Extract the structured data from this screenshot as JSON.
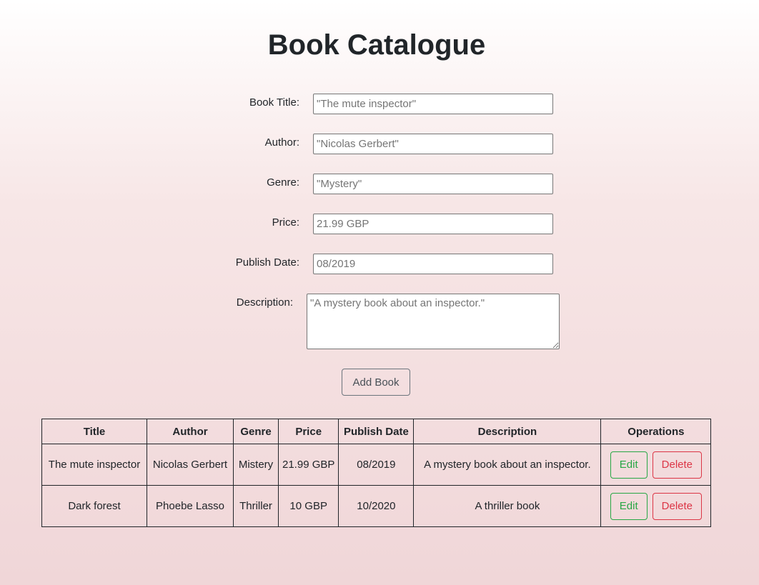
{
  "header": {
    "title": "Book Catalogue"
  },
  "form": {
    "title_label": "Book Title:",
    "title_placeholder": "\"The mute inspector\"",
    "author_label": "Author:",
    "author_placeholder": "\"Nicolas Gerbert\"",
    "genre_label": "Genre:",
    "genre_placeholder": "\"Mystery\"",
    "price_label": "Price:",
    "price_placeholder": "21.99 GBP",
    "date_label": "Publish Date:",
    "date_placeholder": "08/2019",
    "description_label": "Description:",
    "description_placeholder": "\"A mystery book about an inspector.\"",
    "add_label": "Add Book"
  },
  "table": {
    "headers": [
      "Title",
      "Author",
      "Genre",
      "Price",
      "Publish Date",
      "Description",
      "Operations"
    ],
    "rows": [
      {
        "title": "The mute inspector",
        "author": "Nicolas Gerbert",
        "genre": "Mistery",
        "price": "21.99 GBP",
        "date": "08/2019",
        "description": "A mystery book about an inspector.",
        "edit": "Edit",
        "delete": "Delete"
      },
      {
        "title": "Dark forest",
        "author": "Phoebe Lasso",
        "genre": "Thriller",
        "price": "10 GBP",
        "date": "10/2020",
        "description": "A thriller book",
        "edit": "Edit",
        "delete": "Delete"
      }
    ]
  },
  "colors": {
    "edit": "#28a745",
    "delete": "#dc3545"
  }
}
